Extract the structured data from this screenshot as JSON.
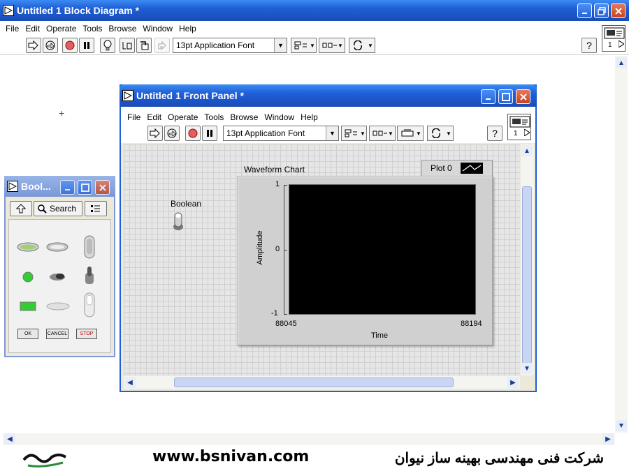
{
  "block_diagram": {
    "title": "Untitled 1 Block Diagram *",
    "menu": [
      "File",
      "Edit",
      "Operate",
      "Tools",
      "Browse",
      "Window",
      "Help"
    ],
    "font_select": "13pt Application Font",
    "help_label": "?",
    "icon_number": "1"
  },
  "front_panel": {
    "title": "Untitled 1 Front Panel *",
    "menu": [
      "File",
      "Edit",
      "Operate",
      "Tools",
      "Browse",
      "Window",
      "Help"
    ],
    "font_select": "13pt Application Font",
    "help_label": "?",
    "icon_number": "1",
    "boolean_label": "Boolean",
    "chart": {
      "title": "Waveform Chart",
      "legend_label": "Plot 0",
      "y_label": "Amplitude",
      "x_label": "Time",
      "y_ticks": [
        "1",
        "0",
        "-1"
      ],
      "x_ticks": [
        "88045",
        "88194"
      ]
    }
  },
  "boolean_palette": {
    "title": "Bool...",
    "search_label": "Search",
    "buttons": [
      "OK",
      "CANCEL",
      "STOP"
    ]
  },
  "footer": {
    "url": "www.bsnivan.com",
    "company": "شرکت فنی مهندسی بهینه ساز نیوان"
  },
  "colors": {
    "xp_blue": "#1f5fd6",
    "chart_plot_bg": "#000000",
    "chart_frame": "#d2d2d2"
  }
}
